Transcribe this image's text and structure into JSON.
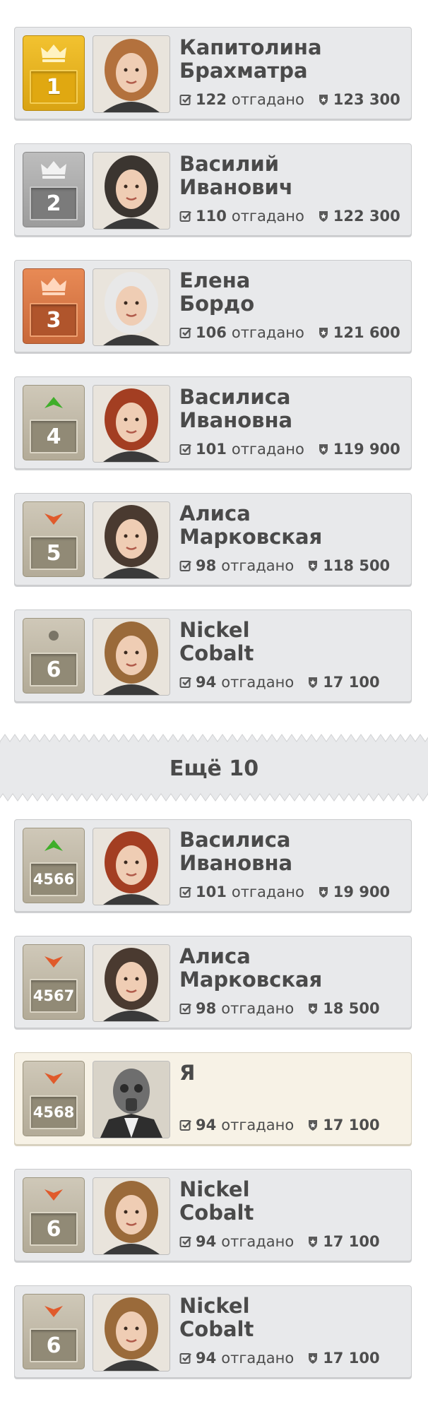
{
  "more_label": "Ещё 10",
  "solved_word": "отгадано",
  "colors": {
    "gold": "#f2c230",
    "silver": "#a8a8a8",
    "bronze": "#d9743f",
    "up": "#3fae2a",
    "down": "#e05a2b"
  },
  "entries": [
    {
      "rank": "1",
      "first": "Капитолина",
      "last": "Брахматра",
      "solved": "122",
      "score": "123 300",
      "badge": "gold",
      "indicator": "crown-icon",
      "hair": "#b3713d"
    },
    {
      "rank": "2",
      "first": "Василий",
      "last": "Иванович",
      "solved": "110",
      "score": "122 300",
      "badge": "silver",
      "indicator": "crown-icon",
      "hair": "#3b3530"
    },
    {
      "rank": "3",
      "first": "Елена",
      "last": "Бордо",
      "solved": "106",
      "score": "121 600",
      "badge": "bronze",
      "indicator": "crown-icon",
      "hair": "#e8e8e8"
    },
    {
      "rank": "4",
      "first": "Василиса",
      "last": "Ивановна",
      "solved": "101",
      "score": "119 900",
      "badge": "grey",
      "indicator": "arrow-up-icon",
      "hair": "#a33e22"
    },
    {
      "rank": "5",
      "first": "Алиса",
      "last": "Марковская",
      "solved": "98",
      "score": "118 500",
      "badge": "grey",
      "indicator": "arrow-down-icon",
      "hair": "#4a3a30"
    },
    {
      "rank": "6",
      "first": "Nickel",
      "last": "Cobalt",
      "solved": "94",
      "score": "17 100",
      "badge": "grey",
      "indicator": "dot-icon",
      "hair": "#9a6a3a"
    },
    {
      "rank": "4566",
      "first": "Василиса",
      "last": "Ивановна",
      "solved": "101",
      "score": "19 900",
      "badge": "grey",
      "indicator": "arrow-up-icon",
      "hair": "#a33e22"
    },
    {
      "rank": "4567",
      "first": "Алиса",
      "last": "Марковская",
      "solved": "98",
      "score": "18 500",
      "badge": "grey",
      "indicator": "arrow-down-icon",
      "hair": "#4a3a30"
    },
    {
      "rank": "4568",
      "first": "Я",
      "last": "",
      "solved": "94",
      "score": "17 100",
      "badge": "grey",
      "indicator": "arrow-down-icon",
      "hair": "#8a8a8a",
      "me": true
    },
    {
      "rank": "6",
      "first": "Nickel",
      "last": "Cobalt",
      "solved": "94",
      "score": "17 100",
      "badge": "grey",
      "indicator": "arrow-down-icon",
      "hair": "#9a6a3a"
    },
    {
      "rank": "6",
      "first": "Nickel",
      "last": "Cobalt",
      "solved": "94",
      "score": "17 100",
      "badge": "grey",
      "indicator": "arrow-down-icon",
      "hair": "#9a6a3a"
    }
  ]
}
